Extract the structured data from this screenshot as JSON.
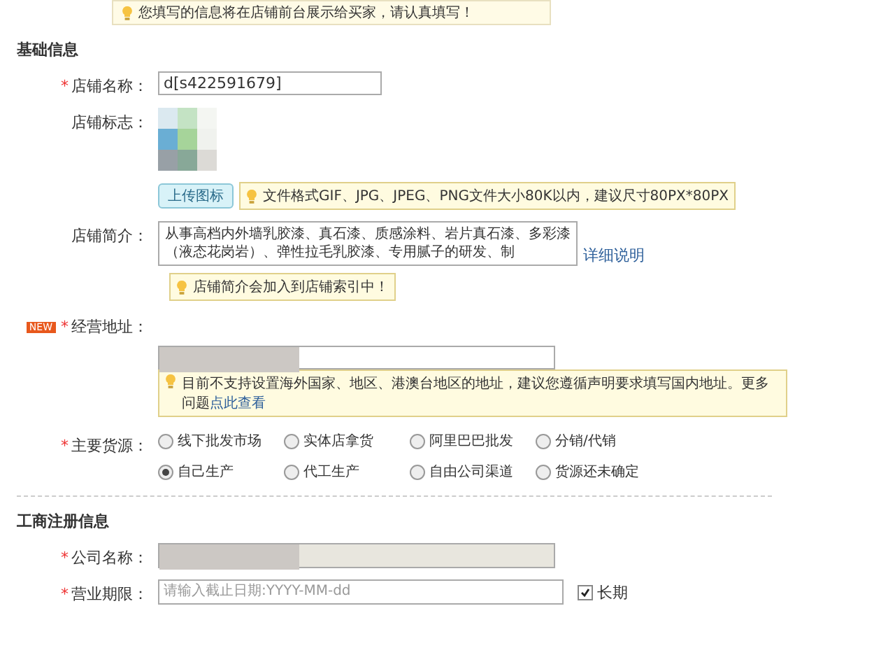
{
  "notice": "您填写的信息将在店铺前台展示给买家，请认真填写！",
  "basic_info": {
    "title": "基础信息",
    "store_name": {
      "label": "店铺名称：",
      "required_mark": "*",
      "value": "d[s422591679]"
    },
    "store_logo": {
      "label": "店铺标志：",
      "upload_button": "上传图标",
      "tip": "文件格式GIF、JPG、JPEG、PNG文件大小80K以内，建议尺寸80PX*80PX"
    },
    "store_intro": {
      "label": "店铺简介：",
      "value": "从事高档内外墙乳胶漆、真石漆、质感涂料、岩片真石漆、多彩漆（液态花岗岩）、弹性拉毛乳胶漆、专用腻子的研发、制",
      "link": "详细说明",
      "tip": "店铺简介会加入到店铺索引中！"
    },
    "business_address": {
      "badge": "NEW",
      "label": "经营地址：",
      "required_mark": "*",
      "tip": "目前不支持设置海外国家、地区、港澳台地区的地址，建议您遵循声明要求填写国内地址。更多问题",
      "tip_link": "点此查看"
    },
    "supply_source": {
      "label": "主要货源：",
      "required_mark": "*",
      "options": [
        {
          "label": "线下批发市场",
          "selected": false
        },
        {
          "label": "实体店拿货",
          "selected": false
        },
        {
          "label": "阿里巴巴批发",
          "selected": false
        },
        {
          "label": "分销/代销",
          "selected": false
        },
        {
          "label": "自己生产",
          "selected": true
        },
        {
          "label": "代工生产",
          "selected": false
        },
        {
          "label": "自由公司渠道",
          "selected": false
        },
        {
          "label": "货源还未确定",
          "selected": false
        }
      ]
    }
  },
  "business_registration": {
    "title": "工商注册信息",
    "company_name": {
      "label": "公司名称：",
      "required_mark": "*",
      "disabled": true
    },
    "business_term": {
      "label": "营业期限：",
      "required_mark": "*",
      "placeholder": "请输入截止日期:YYYY-MM-dd",
      "long_term": {
        "label": "长期",
        "checked": true
      }
    }
  }
}
